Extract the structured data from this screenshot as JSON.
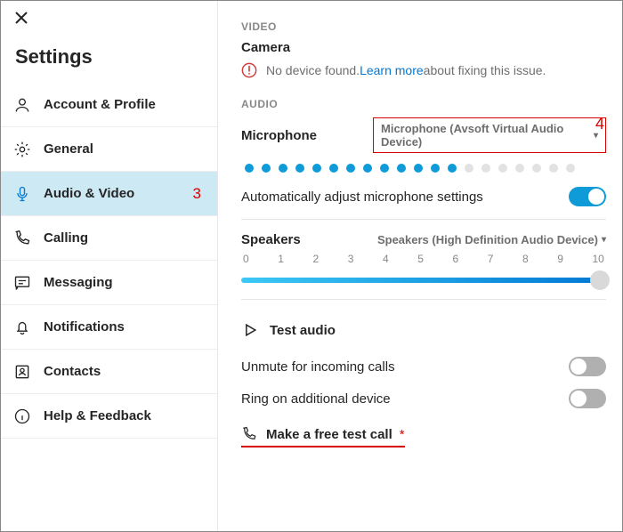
{
  "sidebar": {
    "title": "Settings",
    "items": [
      {
        "label": "Account & Profile",
        "active": false
      },
      {
        "label": "General",
        "active": false
      },
      {
        "label": "Audio & Video",
        "active": true
      },
      {
        "label": "Calling",
        "active": false
      },
      {
        "label": "Messaging",
        "active": false
      },
      {
        "label": "Notifications",
        "active": false
      },
      {
        "label": "Contacts",
        "active": false
      },
      {
        "label": "Help & Feedback",
        "active": false
      }
    ]
  },
  "annotations": {
    "sidebar_marker": "3",
    "device_marker": "4",
    "star": "*"
  },
  "video": {
    "section_label": "VIDEO",
    "camera_label": "Camera",
    "warning_pre": "No device found. ",
    "warning_link": "Learn more",
    "warning_post": " about fixing this issue."
  },
  "audio": {
    "section_label": "AUDIO",
    "microphone_label": "Microphone",
    "microphone_device": "Microphone (Avsoft Virtual Audio Device)",
    "mic_level_active_dots": 13,
    "mic_level_total_dots": 20,
    "auto_adjust_label": "Automatically adjust microphone settings",
    "auto_adjust_on": true,
    "speakers_label": "Speakers",
    "speakers_device": "Speakers (High Definition Audio Device)",
    "slider_ticks": [
      "0",
      "1",
      "2",
      "3",
      "4",
      "5",
      "6",
      "7",
      "8",
      "9",
      "10"
    ],
    "slider_value": 10,
    "test_audio_label": "Test audio",
    "unmute_label": "Unmute for incoming calls",
    "unmute_on": false,
    "ring_label": "Ring on additional device",
    "ring_on": false,
    "test_call_label": "Make a free test call"
  }
}
